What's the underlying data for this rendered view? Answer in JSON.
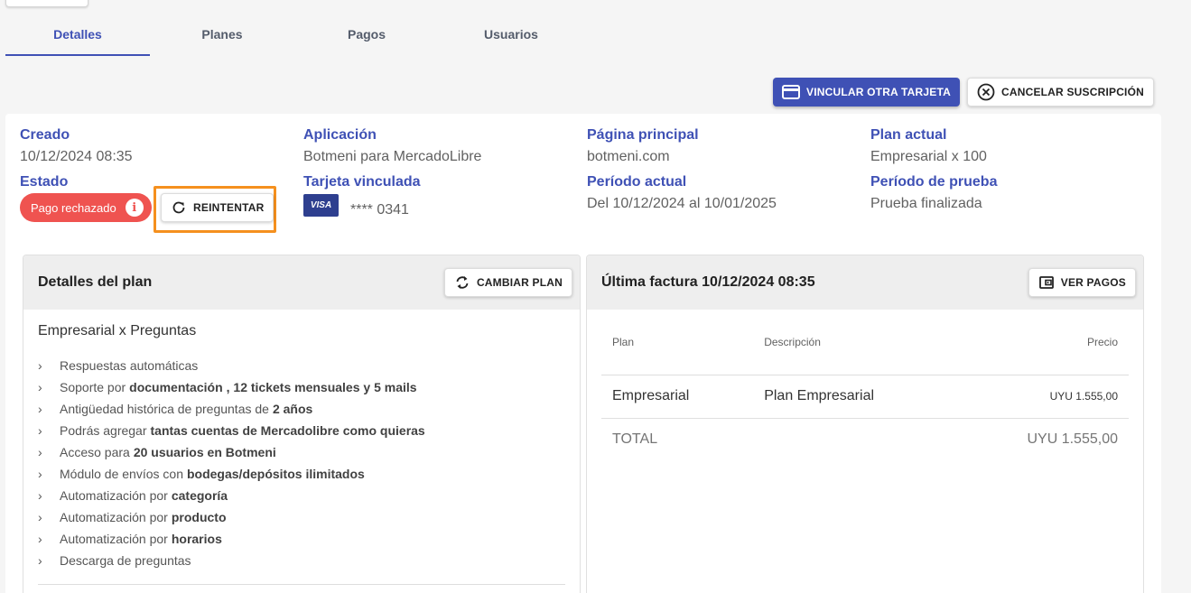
{
  "tabs": [
    {
      "label": "Detalles",
      "active": true
    },
    {
      "label": "Planes",
      "active": false
    },
    {
      "label": "Pagos",
      "active": false
    },
    {
      "label": "Usuarios",
      "active": false
    }
  ],
  "actions": {
    "link_card": "VINCULAR OTRA TARJETA",
    "cancel_subscription": "CANCELAR SUSCRIPCIÓN"
  },
  "summary": {
    "created_label": "Creado",
    "created_value": "10/12/2024 08:35",
    "status_label": "Estado",
    "status_badge": "Pago rechazado",
    "retry_button": "REINTENTAR",
    "app_label": "Aplicación",
    "app_value": "Botmeni para MercadoLibre",
    "card_label": "Tarjeta vinculada",
    "card_brand": "VISA",
    "card_number": "**** 0341",
    "homepage_label": "Página principal",
    "homepage_value": "botmeni.com",
    "period_label": "Período actual",
    "period_value": "Del 10/12/2024 al 10/01/2025",
    "plan_label": "Plan actual",
    "plan_value": "Empresarial x 100",
    "trial_label": "Período de prueba",
    "trial_value": "Prueba finalizada"
  },
  "plan_panel": {
    "title": "Detalles del plan",
    "change_button": "CAMBIAR PLAN",
    "plan_name": "Empresarial x Preguntas",
    "features": [
      {
        "pre": "Respuestas automáticas",
        "bold": "",
        "post": ""
      },
      {
        "pre": "Soporte por",
        "bold": "documentación",
        "post": ", 12 tickets mensuales y 5 mails"
      },
      {
        "pre": "Antigüedad histórica de preguntas de",
        "bold": "2 años",
        "post": ""
      },
      {
        "pre": "Podrás agregar",
        "bold": "tantas cuentas de Mercadolibre como quieras",
        "post": ""
      },
      {
        "pre": "Acceso para",
        "bold": "20 usuarios en Botmeni",
        "post": ""
      },
      {
        "pre": "Módulo de envíos con",
        "bold": "bodegas/depósitos ilimitados",
        "post": ""
      },
      {
        "pre": "Automatización por",
        "bold": "categoría",
        "post": ""
      },
      {
        "pre": "Automatización por",
        "bold": "producto",
        "post": ""
      },
      {
        "pre": "Automatización por",
        "bold": "horarios",
        "post": ""
      },
      {
        "pre": "Descarga de preguntas",
        "bold": "",
        "post": ""
      }
    ]
  },
  "invoice_panel": {
    "title": "Última factura 10/12/2024 08:35",
    "payments_button": "VER PAGOS",
    "columns": [
      "Plan",
      "Descripción",
      "Precio"
    ],
    "rows": [
      {
        "plan": "Empresarial",
        "description": "Plan Empresarial",
        "price": "UYU 1.555,00"
      }
    ],
    "total_label": "TOTAL",
    "total_value": "UYU 1.555,00"
  },
  "colors": {
    "accent": "#3f51b5",
    "error": "#ef5350",
    "highlight": "#f5901e"
  }
}
